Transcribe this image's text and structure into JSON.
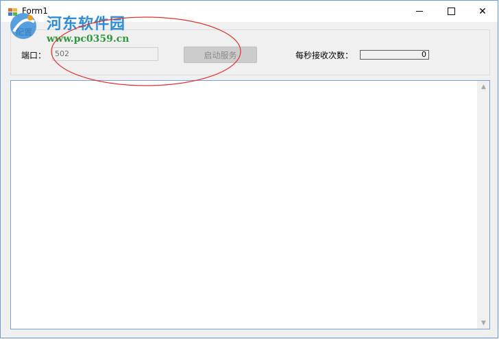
{
  "window": {
    "title": "Form1",
    "minimize_glyph": "—",
    "close_glyph": "✕"
  },
  "group": {
    "legend": "配置"
  },
  "port": {
    "label": "端口：",
    "value": "502"
  },
  "start_button": {
    "label": "启动服务"
  },
  "rate": {
    "label": "每秒接收次数：",
    "value": "0"
  },
  "watermark": {
    "name": "河东软件园",
    "url": "www.pc0359.cn"
  },
  "colors": {
    "window_border": "#6b9bd1",
    "annotation": "#e03030"
  }
}
